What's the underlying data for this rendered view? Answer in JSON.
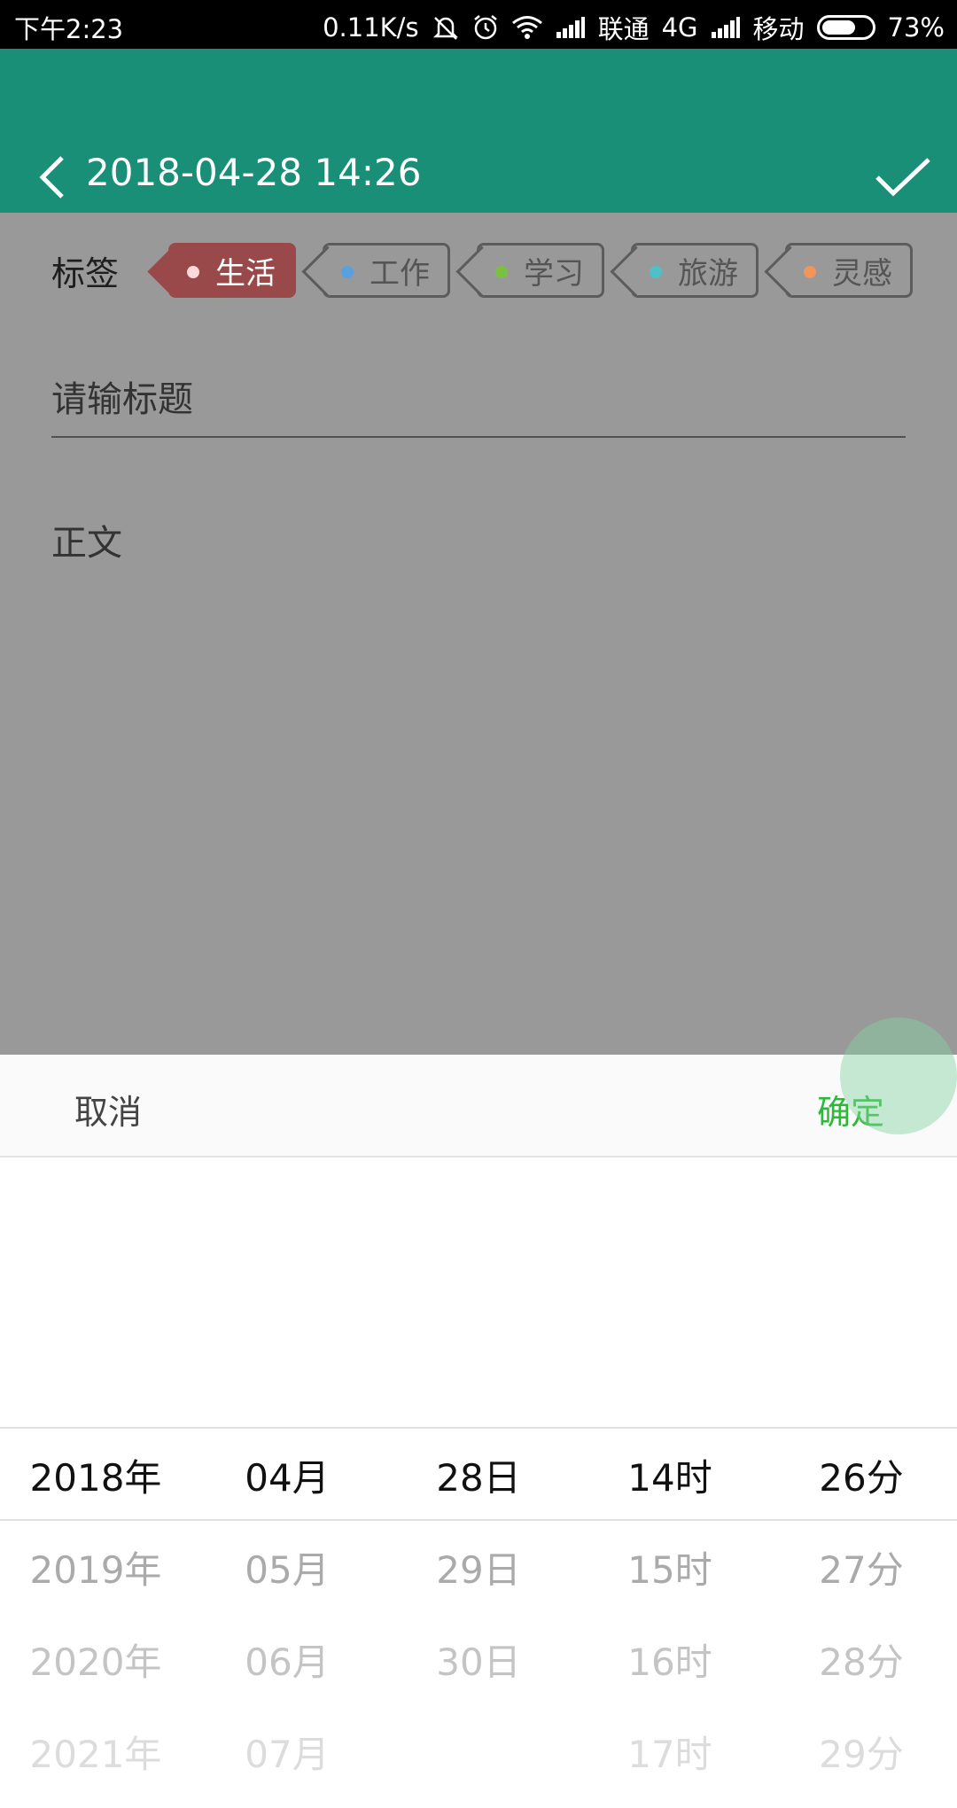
{
  "status_bar": {
    "time": "下午2:23",
    "speed": "0.11K/s",
    "carrier1": "联通",
    "network": "4G",
    "carrier2": "移动",
    "battery": "73%",
    "battery_level": 0.73,
    "icons": [
      "mute-icon",
      "alarm-icon",
      "wifi-icon",
      "signal-icon",
      "signal-icon",
      "battery-icon"
    ]
  },
  "header": {
    "title": "2018-04-28 14:26",
    "back_icon": "chevron-left-icon",
    "save_icon": "checkmark-icon",
    "color": "#1a8f77"
  },
  "tags": {
    "label": "标签",
    "items": [
      {
        "label": "生活",
        "dot": "#ff7b7b",
        "active": true
      },
      {
        "label": "工作",
        "dot": "#5aa0e0",
        "active": false
      },
      {
        "label": "学习",
        "dot": "#7ac143",
        "active": false
      },
      {
        "label": "旅游",
        "dot": "#4fc0c8",
        "active": false
      },
      {
        "label": "灵感",
        "dot": "#f0965a",
        "active": false
      }
    ]
  },
  "form": {
    "title_placeholder": "请输标题",
    "body_placeholder": "正文"
  },
  "sheet": {
    "cancel": "取消",
    "confirm": "确定",
    "confirm_color": "#2eb83a"
  },
  "picker": {
    "columns": [
      {
        "name": "year",
        "options": [
          "2018年",
          "2019年",
          "2020年",
          "2021年"
        ]
      },
      {
        "name": "month",
        "options": [
          "04月",
          "05月",
          "06月",
          "07月"
        ]
      },
      {
        "name": "day",
        "options": [
          "28日",
          "29日",
          "30日"
        ]
      },
      {
        "name": "hour",
        "options": [
          "14时",
          "15时",
          "16时",
          "17时"
        ]
      },
      {
        "name": "minute",
        "options": [
          "26分",
          "27分",
          "28分",
          "29分"
        ]
      }
    ]
  }
}
